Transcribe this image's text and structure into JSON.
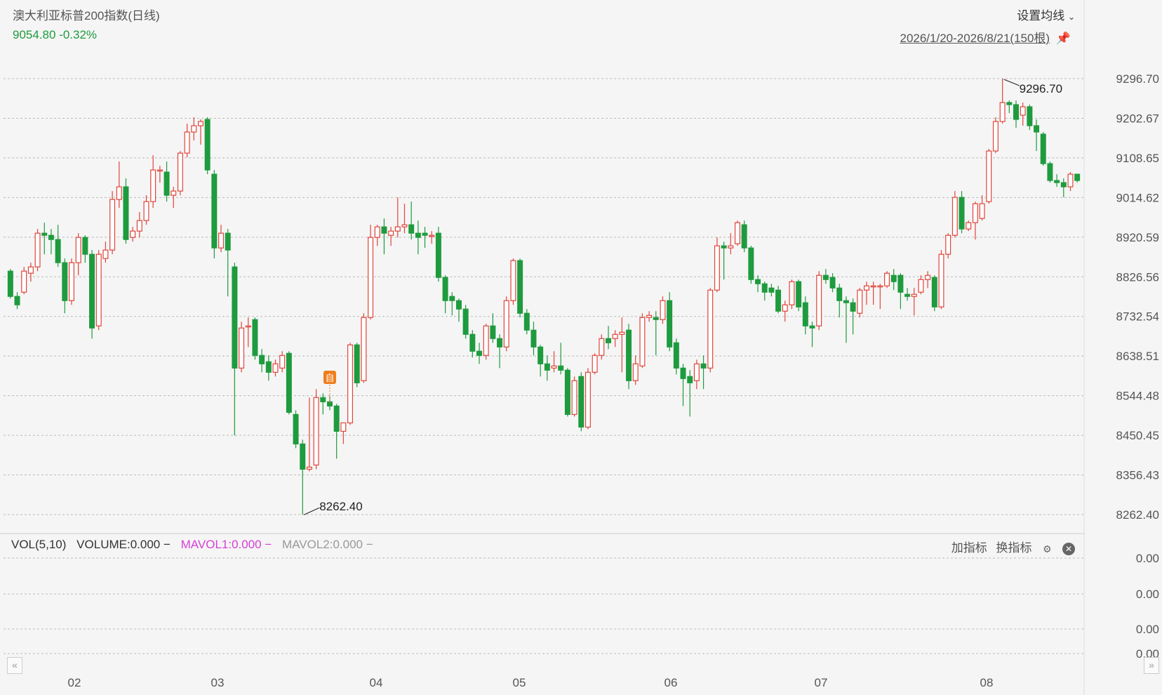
{
  "header": {
    "title": "澳大利亚标普200指数(日线)",
    "price": "9054.80",
    "change": "-0.32%",
    "ma_settings": "设置均线",
    "range": "2026/1/20-2026/8/21(150根)",
    "colors": {
      "up": "#e0443a",
      "down": "#1e9b3e",
      "change_text": "#1e9b3e"
    }
  },
  "chart_data": {
    "type": "candlestick",
    "y_ticks": [
      "9296.70",
      "9202.67",
      "9108.65",
      "9014.62",
      "8920.59",
      "8826.56",
      "8732.54",
      "8638.51",
      "8544.48",
      "8450.45",
      "8356.43",
      "8262.40"
    ],
    "ylim": [
      8262.4,
      9296.7
    ],
    "x_ticks": [
      "02",
      "03",
      "04",
      "05",
      "06",
      "07",
      "08"
    ],
    "annotations": {
      "high": "9296.70",
      "low": "8262.40",
      "marker": "自"
    },
    "candles": [
      {
        "o": 8840,
        "h": 8845,
        "c": 8780,
        "l": 8775
      },
      {
        "o": 8780,
        "h": 8790,
        "c": 8760,
        "l": 8750
      },
      {
        "o": 8790,
        "h": 8850,
        "c": 8840,
        "l": 8785
      },
      {
        "o": 8835,
        "h": 8860,
        "c": 8850,
        "l": 8815
      },
      {
        "o": 8850,
        "h": 8940,
        "c": 8930,
        "l": 8840
      },
      {
        "o": 8930,
        "h": 8955,
        "c": 8925,
        "l": 8880
      },
      {
        "o": 8925,
        "h": 8940,
        "c": 8915,
        "l": 8880
      },
      {
        "o": 8915,
        "h": 8950,
        "c": 8860,
        "l": 8850
      },
      {
        "o": 8860,
        "h": 8870,
        "c": 8770,
        "l": 8740
      },
      {
        "o": 8770,
        "h": 8870,
        "c": 8860,
        "l": 8760
      },
      {
        "o": 8860,
        "h": 8930,
        "c": 8920,
        "l": 8830
      },
      {
        "o": 8920,
        "h": 8925,
        "c": 8880,
        "l": 8860
      },
      {
        "o": 8880,
        "h": 8890,
        "c": 8705,
        "l": 8680
      },
      {
        "o": 8710,
        "h": 8890,
        "c": 8880,
        "l": 8700
      },
      {
        "o": 8870,
        "h": 8910,
        "c": 8890,
        "l": 8860
      },
      {
        "o": 8890,
        "h": 9030,
        "c": 9010,
        "l": 8880
      },
      {
        "o": 9010,
        "h": 9100,
        "c": 9040,
        "l": 8990
      },
      {
        "o": 9040,
        "h": 9060,
        "c": 8915,
        "l": 8905
      },
      {
        "o": 8920,
        "h": 8945,
        "c": 8935,
        "l": 8910
      },
      {
        "o": 8935,
        "h": 8980,
        "c": 8960,
        "l": 8920
      },
      {
        "o": 8960,
        "h": 9020,
        "c": 9005,
        "l": 8950
      },
      {
        "o": 9005,
        "h": 9115,
        "c": 9080,
        "l": 8990
      },
      {
        "o": 9080,
        "h": 9090,
        "c": 9080,
        "l": 9050
      },
      {
        "o": 9075,
        "h": 9100,
        "c": 9020,
        "l": 9005
      },
      {
        "o": 9020,
        "h": 9040,
        "c": 9030,
        "l": 8990
      },
      {
        "o": 9030,
        "h": 9125,
        "c": 9120,
        "l": 9020
      },
      {
        "o": 9120,
        "h": 9190,
        "c": 9170,
        "l": 9110
      },
      {
        "o": 9170,
        "h": 9205,
        "c": 9185,
        "l": 9150
      },
      {
        "o": 9185,
        "h": 9200,
        "c": 9195,
        "l": 9140
      },
      {
        "o": 9200,
        "h": 9205,
        "c": 9080,
        "l": 9070
      },
      {
        "o": 9070,
        "h": 9080,
        "c": 8895,
        "l": 8870
      },
      {
        "o": 8895,
        "h": 8950,
        "c": 8930,
        "l": 8885
      },
      {
        "o": 8930,
        "h": 8940,
        "c": 8890,
        "l": 8780
      },
      {
        "o": 8850,
        "h": 8860,
        "c": 8610,
        "l": 8450
      },
      {
        "o": 8610,
        "h": 8720,
        "c": 8705,
        "l": 8600
      },
      {
        "o": 8710,
        "h": 8730,
        "c": 8710,
        "l": 8660
      },
      {
        "o": 8725,
        "h": 8730,
        "c": 8640,
        "l": 8630
      },
      {
        "o": 8640,
        "h": 8655,
        "c": 8620,
        "l": 8600
      },
      {
        "o": 8625,
        "h": 8640,
        "c": 8600,
        "l": 8580
      },
      {
        "o": 8600,
        "h": 8630,
        "c": 8620,
        "l": 8590
      },
      {
        "o": 8610,
        "h": 8650,
        "c": 8640,
        "l": 8600
      },
      {
        "o": 8645,
        "h": 8650,
        "c": 8505,
        "l": 8500
      },
      {
        "o": 8500,
        "h": 8510,
        "c": 8430,
        "l": 8420
      },
      {
        "o": 8430,
        "h": 8440,
        "c": 8370,
        "l": 8262
      },
      {
        "o": 8370,
        "h": 8540,
        "c": 8375,
        "l": 8365
      },
      {
        "o": 8380,
        "h": 8560,
        "c": 8540,
        "l": 8370
      },
      {
        "o": 8540,
        "h": 8550,
        "c": 8530,
        "l": 8500
      },
      {
        "o": 8530,
        "h": 8545,
        "c": 8520,
        "l": 8510
      },
      {
        "o": 8520,
        "h": 8525,
        "c": 8460,
        "l": 8395
      },
      {
        "o": 8460,
        "h": 8480,
        "c": 8480,
        "l": 8430
      },
      {
        "o": 8480,
        "h": 8670,
        "c": 8665,
        "l": 8475
      },
      {
        "o": 8665,
        "h": 8670,
        "c": 8575,
        "l": 8565
      },
      {
        "o": 8580,
        "h": 8740,
        "c": 8730,
        "l": 8575
      },
      {
        "o": 8730,
        "h": 8950,
        "c": 8920,
        "l": 8725
      },
      {
        "o": 8920,
        "h": 8950,
        "c": 8945,
        "l": 8900
      },
      {
        "o": 8945,
        "h": 8965,
        "c": 8930,
        "l": 8880
      },
      {
        "o": 8925,
        "h": 8945,
        "c": 8935,
        "l": 8900
      },
      {
        "o": 8935,
        "h": 9015,
        "c": 8945,
        "l": 8920
      },
      {
        "o": 8945,
        "h": 9000,
        "c": 8950,
        "l": 8930
      },
      {
        "o": 8950,
        "h": 9005,
        "c": 8930,
        "l": 8915
      },
      {
        "o": 8930,
        "h": 8960,
        "c": 8920,
        "l": 8880
      },
      {
        "o": 8930,
        "h": 8945,
        "c": 8925,
        "l": 8895
      },
      {
        "o": 8925,
        "h": 8935,
        "c": 8925,
        "l": 8905
      },
      {
        "o": 8930,
        "h": 8945,
        "c": 8825,
        "l": 8815
      },
      {
        "o": 8825,
        "h": 8830,
        "c": 8770,
        "l": 8740
      },
      {
        "o": 8780,
        "h": 8790,
        "c": 8770,
        "l": 8735
      },
      {
        "o": 8770,
        "h": 8775,
        "c": 8750,
        "l": 8720
      },
      {
        "o": 8750,
        "h": 8760,
        "c": 8690,
        "l": 8680
      },
      {
        "o": 8690,
        "h": 8700,
        "c": 8650,
        "l": 8635
      },
      {
        "o": 8650,
        "h": 8670,
        "c": 8640,
        "l": 8620
      },
      {
        "o": 8640,
        "h": 8715,
        "c": 8710,
        "l": 8630
      },
      {
        "o": 8710,
        "h": 8740,
        "c": 8680,
        "l": 8670
      },
      {
        "o": 8680,
        "h": 8690,
        "c": 8660,
        "l": 8610
      },
      {
        "o": 8660,
        "h": 8780,
        "c": 8770,
        "l": 8650
      },
      {
        "o": 8770,
        "h": 8870,
        "c": 8865,
        "l": 8760
      },
      {
        "o": 8865,
        "h": 8870,
        "c": 8740,
        "l": 8730
      },
      {
        "o": 8740,
        "h": 8750,
        "c": 8700,
        "l": 8690
      },
      {
        "o": 8700,
        "h": 8720,
        "c": 8660,
        "l": 8640
      },
      {
        "o": 8660,
        "h": 8665,
        "c": 8620,
        "l": 8590
      },
      {
        "o": 8620,
        "h": 8640,
        "c": 8605,
        "l": 8580
      },
      {
        "o": 8610,
        "h": 8650,
        "c": 8615,
        "l": 8600
      },
      {
        "o": 8615,
        "h": 8670,
        "c": 8605,
        "l": 8595
      },
      {
        "o": 8605,
        "h": 8610,
        "c": 8500,
        "l": 8495
      },
      {
        "o": 8500,
        "h": 8590,
        "c": 8580,
        "l": 8495
      },
      {
        "o": 8590,
        "h": 8600,
        "c": 8470,
        "l": 8460
      },
      {
        "o": 8470,
        "h": 8610,
        "c": 8600,
        "l": 8465
      },
      {
        "o": 8600,
        "h": 8645,
        "c": 8640,
        "l": 8595
      },
      {
        "o": 8640,
        "h": 8690,
        "c": 8680,
        "l": 8630
      },
      {
        "o": 8680,
        "h": 8710,
        "c": 8670,
        "l": 8655
      },
      {
        "o": 8680,
        "h": 8700,
        "c": 8690,
        "l": 8660
      },
      {
        "o": 8690,
        "h": 8730,
        "c": 8695,
        "l": 8600
      },
      {
        "o": 8700,
        "h": 8715,
        "c": 8580,
        "l": 8560
      },
      {
        "o": 8580,
        "h": 8640,
        "c": 8620,
        "l": 8570
      },
      {
        "o": 8615,
        "h": 8740,
        "c": 8730,
        "l": 8610
      },
      {
        "o": 8730,
        "h": 8745,
        "c": 8735,
        "l": 8720
      },
      {
        "o": 8730,
        "h": 8745,
        "c": 8725,
        "l": 8640
      },
      {
        "o": 8725,
        "h": 8780,
        "c": 8770,
        "l": 8715
      },
      {
        "o": 8770,
        "h": 8790,
        "c": 8660,
        "l": 8650
      },
      {
        "o": 8670,
        "h": 8680,
        "c": 8610,
        "l": 8595
      },
      {
        "o": 8610,
        "h": 8620,
        "c": 8585,
        "l": 8520
      },
      {
        "o": 8590,
        "h": 8605,
        "c": 8575,
        "l": 8495
      },
      {
        "o": 8580,
        "h": 8630,
        "c": 8620,
        "l": 8560
      },
      {
        "o": 8620,
        "h": 8640,
        "c": 8610,
        "l": 8560
      },
      {
        "o": 8610,
        "h": 8800,
        "c": 8795,
        "l": 8600
      },
      {
        "o": 8795,
        "h": 8920,
        "c": 8900,
        "l": 8790
      },
      {
        "o": 8900,
        "h": 8910,
        "c": 8895,
        "l": 8820
      },
      {
        "o": 8895,
        "h": 8930,
        "c": 8900,
        "l": 8880
      },
      {
        "o": 8905,
        "h": 8960,
        "c": 8955,
        "l": 8900
      },
      {
        "o": 8950,
        "h": 8960,
        "c": 8895,
        "l": 8885
      },
      {
        "o": 8895,
        "h": 8900,
        "c": 8820,
        "l": 8810
      },
      {
        "o": 8820,
        "h": 8830,
        "c": 8810,
        "l": 8790
      },
      {
        "o": 8810,
        "h": 8815,
        "c": 8790,
        "l": 8770
      },
      {
        "o": 8800,
        "h": 8810,
        "c": 8790,
        "l": 8780
      },
      {
        "o": 8795,
        "h": 8805,
        "c": 8745,
        "l": 8740
      },
      {
        "o": 8745,
        "h": 8770,
        "c": 8760,
        "l": 8720
      },
      {
        "o": 8760,
        "h": 8820,
        "c": 8815,
        "l": 8750
      },
      {
        "o": 8815,
        "h": 8820,
        "c": 8755,
        "l": 8745
      },
      {
        "o": 8765,
        "h": 8780,
        "c": 8710,
        "l": 8690
      },
      {
        "o": 8710,
        "h": 8720,
        "c": 8705,
        "l": 8660
      },
      {
        "o": 8710,
        "h": 8840,
        "c": 8830,
        "l": 8700
      },
      {
        "o": 8830,
        "h": 8845,
        "c": 8820,
        "l": 8810
      },
      {
        "o": 8825,
        "h": 8835,
        "c": 8800,
        "l": 8790
      },
      {
        "o": 8800,
        "h": 8810,
        "c": 8770,
        "l": 8730
      },
      {
        "o": 8770,
        "h": 8780,
        "c": 8765,
        "l": 8670
      },
      {
        "o": 8765,
        "h": 8775,
        "c": 8745,
        "l": 8690
      },
      {
        "o": 8740,
        "h": 8800,
        "c": 8795,
        "l": 8730
      },
      {
        "o": 8795,
        "h": 8815,
        "c": 8805,
        "l": 8760
      },
      {
        "o": 8805,
        "h": 8815,
        "c": 8805,
        "l": 8760
      },
      {
        "o": 8805,
        "h": 8810,
        "c": 8805,
        "l": 8750
      },
      {
        "o": 8805,
        "h": 8840,
        "c": 8835,
        "l": 8800
      },
      {
        "o": 8830,
        "h": 8845,
        "c": 8815,
        "l": 8795
      },
      {
        "o": 8830,
        "h": 8835,
        "c": 8790,
        "l": 8750
      },
      {
        "o": 8785,
        "h": 8800,
        "c": 8780,
        "l": 8770
      },
      {
        "o": 8780,
        "h": 8800,
        "c": 8785,
        "l": 8735
      },
      {
        "o": 8790,
        "h": 8830,
        "c": 8820,
        "l": 8785
      },
      {
        "o": 8820,
        "h": 8840,
        "c": 8830,
        "l": 8800
      },
      {
        "o": 8825,
        "h": 8830,
        "c": 8755,
        "l": 8745
      },
      {
        "o": 8755,
        "h": 8890,
        "c": 8880,
        "l": 8750
      },
      {
        "o": 8880,
        "h": 8930,
        "c": 8925,
        "l": 8870
      },
      {
        "o": 8925,
        "h": 9030,
        "c": 9015,
        "l": 8920
      },
      {
        "o": 9015,
        "h": 9030,
        "c": 8940,
        "l": 8930
      },
      {
        "o": 8940,
        "h": 8960,
        "c": 8955,
        "l": 8935
      },
      {
        "o": 8955,
        "h": 9005,
        "c": 9000,
        "l": 8915
      },
      {
        "o": 8965,
        "h": 9020,
        "c": 9000,
        "l": 8960
      },
      {
        "o": 9005,
        "h": 9130,
        "c": 9125,
        "l": 9000
      },
      {
        "o": 9125,
        "h": 9205,
        "c": 9195,
        "l": 9120
      },
      {
        "o": 9195,
        "h": 9296.7,
        "c": 9240,
        "l": 9190
      },
      {
        "o": 9240,
        "h": 9245,
        "c": 9235,
        "l": 9215
      },
      {
        "o": 9235,
        "h": 9245,
        "c": 9200,
        "l": 9180
      },
      {
        "o": 9210,
        "h": 9240,
        "c": 9230,
        "l": 9185
      },
      {
        "o": 9230,
        "h": 9235,
        "c": 9185,
        "l": 9175
      },
      {
        "o": 9185,
        "h": 9200,
        "c": 9170,
        "l": 9125
      },
      {
        "o": 9165,
        "h": 9170,
        "c": 9095,
        "l": 9090
      },
      {
        "o": 9095,
        "h": 9100,
        "c": 9055,
        "l": 9050
      },
      {
        "o": 9055,
        "h": 9070,
        "c": 9050,
        "l": 9040
      },
      {
        "o": 9050,
        "h": 9060,
        "c": 9040,
        "l": 9015
      },
      {
        "o": 9040,
        "h": 9075,
        "c": 9070,
        "l": 9030
      },
      {
        "o": 9070,
        "h": 9070,
        "c": 9055,
        "l": 9050
      }
    ]
  },
  "volume": {
    "label": "VOL(5,10)",
    "volume": "VOLUME:0.000",
    "mavol1": "MAVOL1:0.000",
    "mavol2": "MAVOL2:0.000",
    "dash": "−",
    "ticks": [
      "0.00",
      "0.00",
      "0.00",
      "0.00"
    ],
    "add_indicator": "加指标",
    "switch_indicator": "换指标",
    "colors": {
      "mavol1": "#d63fd6",
      "mavol2": "#999999"
    }
  }
}
